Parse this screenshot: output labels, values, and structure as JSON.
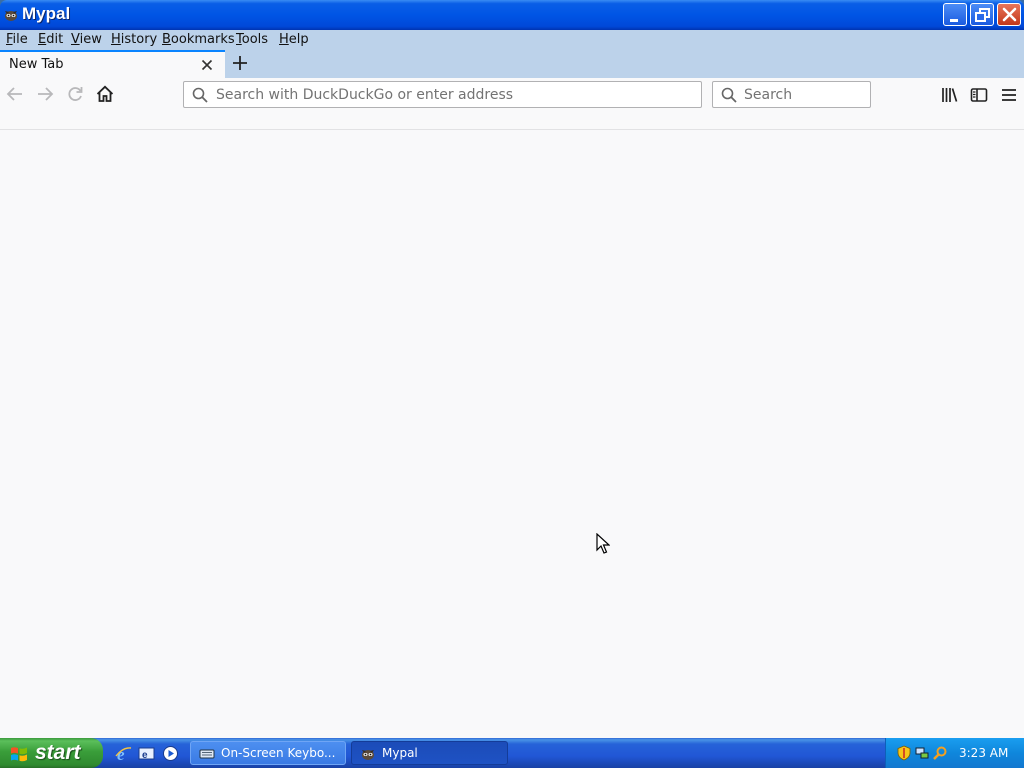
{
  "window": {
    "title": "Mypal",
    "app_icon": "mypal-raccoon-icon",
    "controls": [
      "minimize-icon",
      "restore-icon",
      "close-icon"
    ]
  },
  "menubar": {
    "items": [
      {
        "label": "File",
        "mnemonic": "F",
        "rest": "ile"
      },
      {
        "label": "Edit",
        "mnemonic": "E",
        "rest": "dit"
      },
      {
        "label": "View",
        "mnemonic": "V",
        "rest": "iew"
      },
      {
        "label": "History",
        "mnemonic": "H",
        "rest": "istory"
      },
      {
        "label": "Bookmarks",
        "mnemonic": "B",
        "rest": "ookmarks"
      },
      {
        "label": "Tools",
        "mnemonic": "T",
        "rest": "ools"
      },
      {
        "label": "Help",
        "mnemonic": "H",
        "rest": "elp"
      }
    ]
  },
  "tabs": {
    "active": {
      "label": "New Tab"
    },
    "new_tab_icon": "plus-icon"
  },
  "navbar": {
    "buttons": [
      "back-arrow-icon",
      "forward-arrow-icon",
      "reload-icon",
      "home-icon"
    ],
    "urlbar": {
      "placeholder": "Search with DuckDuckGo or enter address",
      "value": ""
    },
    "searchbar": {
      "placeholder": "Search",
      "value": ""
    },
    "right_buttons": [
      "library-icon",
      "sidebar-icon",
      "hamburger-menu-icon"
    ]
  },
  "taskbar": {
    "start_label": "start",
    "quick_launch": [
      "internet-explorer-icon",
      "outlook-express-icon",
      "media-player-icon"
    ],
    "tasks": [
      {
        "label": "On-Screen Keybo...",
        "icon": "keyboard-icon",
        "active": false
      },
      {
        "label": "Mypal",
        "icon": "mypal-raccoon-icon",
        "active": true
      }
    ],
    "tray_icons": [
      "security-shield-icon",
      "network-icon",
      "search-tray-icon"
    ],
    "clock": "3:23 AM"
  },
  "colors": {
    "titlebar": "#0055e5",
    "menubar_bg": "#bcd2ea",
    "tab_accent": "#0a84ff",
    "content_bg": "#f9f9fa",
    "taskbar": "#2157d6",
    "start_green": "#3a9e3a"
  }
}
